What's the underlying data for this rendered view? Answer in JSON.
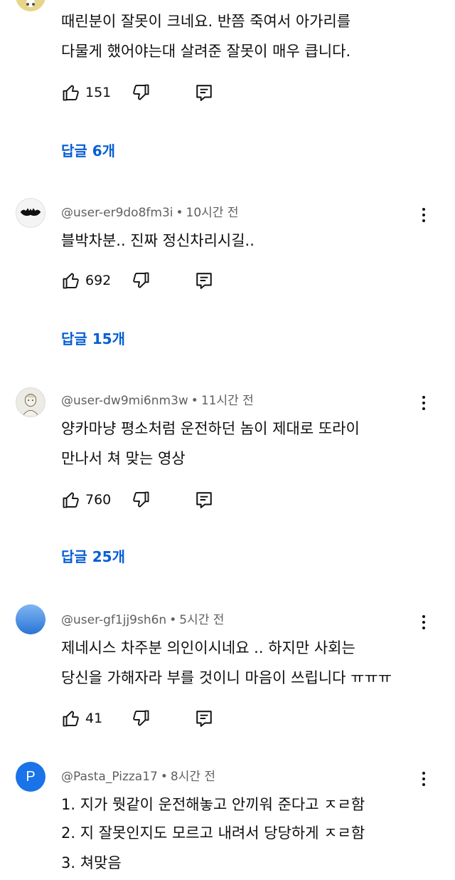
{
  "comments": [
    {
      "lines": [
        "때린분이 잘못이 크네요. 반쯤 죽여서 아가리를",
        "다물게 했어야는대 살려준 잘못이 매우 큽니다."
      ],
      "likes": "151",
      "replies": "답글 6개"
    },
    {
      "author": "@user-er9do8fm3i",
      "dot": "•",
      "time": "10시간 전",
      "lines": [
        "블박차분.. 진짜 정신차리시길.."
      ],
      "likes": "692",
      "replies": "답글 15개"
    },
    {
      "author": "@user-dw9mi6nm3w",
      "dot": "•",
      "time": "11시간 전",
      "lines": [
        "양카마냥 평소처럼 운전하던 놈이 제대로 또라이",
        "만나서 쳐 맞는 영상"
      ],
      "likes": "760",
      "replies": "답글 25개"
    },
    {
      "author": "@user-gf1jj9sh6n",
      "dot": "•",
      "time": "5시간 전",
      "lines": [
        "제네시스 차주분 의인이시네요 .. 하지만 사회는",
        "당신을 가해자라 부를 것이니 마음이 쓰립니다 ㅠㅠㅠ"
      ],
      "likes": "41"
    },
    {
      "author": "@Pasta_Pizza17",
      "dot": "•",
      "time": "8시간 전",
      "avatar_letter": "P",
      "lines": [
        "1. 지가 뭣같이 운전해놓고 안끼워 준다고 ㅈㄹ함",
        "2. 지 잘못인지도 모르고 내려서 당당하게 ㅈㄹ함",
        "3. 쳐맞음"
      ]
    }
  ],
  "colors": {
    "reply_link": "#065fd4",
    "meta": "#606060",
    "text": "#0f0f0f",
    "avatar_blue": "#3f8fe6",
    "avatar_p": "#1a73e8"
  },
  "icons": [
    "thumb-up-icon",
    "thumb-down-icon",
    "reply-icon",
    "more-vert-icon"
  ]
}
